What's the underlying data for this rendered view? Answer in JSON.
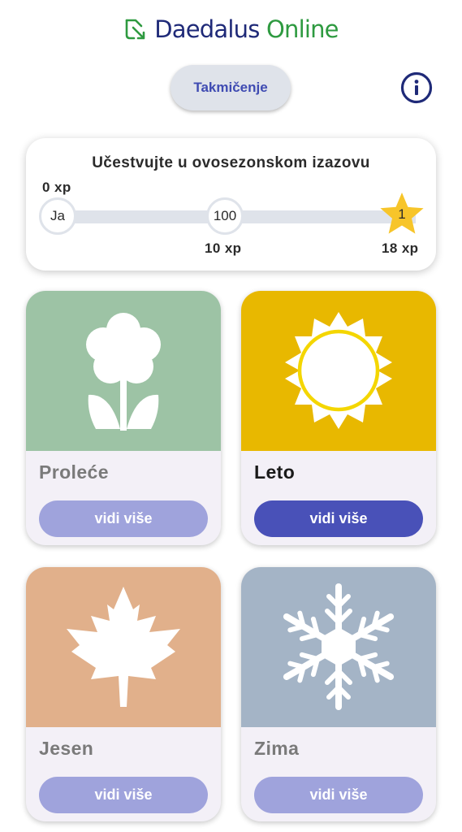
{
  "header": {
    "brand_part1": "Daedalus",
    "brand_part2": "Online",
    "competition_label": "Takmičenje",
    "info_icon": "info-icon"
  },
  "challenge": {
    "title": "Učestvujte u ovosezonskom izazovu",
    "progress": {
      "you_label": "Ja",
      "start_xp": "0 xp",
      "checkpoint_label": "100",
      "checkpoint_xp": "10 xp",
      "goal_label": "1",
      "goal_xp": "18 xp",
      "goal_icon": "star-icon"
    }
  },
  "seasons": [
    {
      "name": "Proleće",
      "button": "vidi više",
      "icon": "flower-icon",
      "color": "#9dc3a5",
      "active": false
    },
    {
      "name": "Leto",
      "button": "vidi više",
      "icon": "sun-icon",
      "color": "#e8b800",
      "active": true
    },
    {
      "name": "Jesen",
      "button": "vidi više",
      "icon": "maple-leaf-icon",
      "color": "#e1b08b",
      "active": false
    },
    {
      "name": "Zima",
      "button": "vidi više",
      "icon": "snowflake-icon",
      "color": "#a4b4c6",
      "active": false
    }
  ],
  "colors": {
    "accent": "#4951b8",
    "accent_light": "#9fa3dc",
    "brand_blue": "#1f2a78",
    "brand_green": "#2e9a40",
    "star": "#f7c52a",
    "track": "#dfe3ea"
  }
}
